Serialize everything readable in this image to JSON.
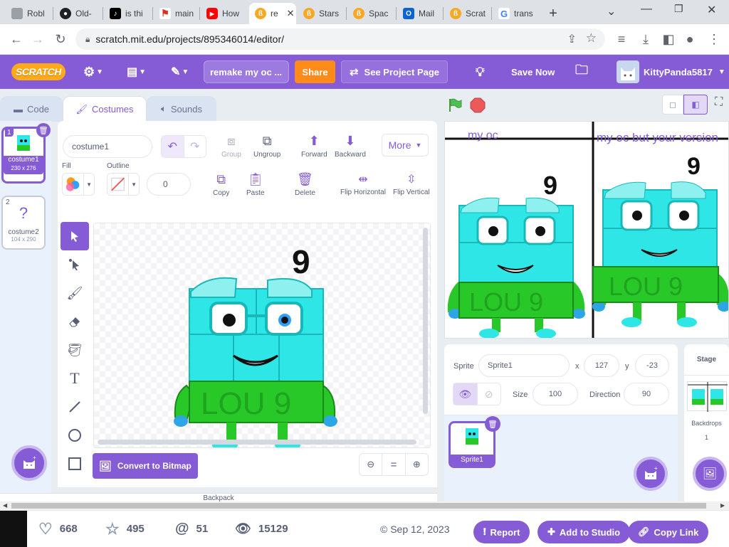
{
  "browser": {
    "tabs": [
      {
        "label": "Robl",
        "icon": "roblox-icon",
        "color": "#9aa0a6"
      },
      {
        "label": "Old-",
        "icon": "github-icon",
        "color": "#202124"
      },
      {
        "label": "is thi",
        "icon": "tiktok-icon",
        "color": "#000000"
      },
      {
        "label": "main",
        "icon": "flag-icon",
        "color": "#d93025"
      },
      {
        "label": "How",
        "icon": "youtube-icon",
        "color": "#ff0000"
      },
      {
        "label": "re",
        "icon": "scratch-tab-icon",
        "color": "#f9a825"
      },
      {
        "label": "Stars",
        "icon": "scratch-tab-icon",
        "color": "#f9a825"
      },
      {
        "label": "Spac",
        "icon": "scratch-tab-icon",
        "color": "#f9a825"
      },
      {
        "label": "Mail",
        "icon": "outlook-icon",
        "color": "#0a64d4"
      },
      {
        "label": "Scrat",
        "icon": "scratch-tab-icon",
        "color": "#f9a825"
      },
      {
        "label": "trans",
        "icon": "google-icon",
        "color": "#4285f4"
      }
    ],
    "new_tab": "+",
    "url": "scratch.mit.edu/projects/895346014/editor/"
  },
  "menubar": {
    "logo": "SCRATCH",
    "project_title": "remake my oc ...",
    "share": "Share",
    "see_project_page": "See Project Page",
    "save_now": "Save Now",
    "username": "KittyPanda5817"
  },
  "editor_tabs": {
    "code": "Code",
    "costumes": "Costumes",
    "sounds": "Sounds"
  },
  "costumes": [
    {
      "index": "1",
      "name": "costume1",
      "size": "230 x 276",
      "selected": true
    },
    {
      "index": "2",
      "name": "costume2",
      "size": "104 x 290",
      "selected": false
    }
  ],
  "paint": {
    "costume_name": "costume1",
    "group": "Group",
    "ungroup": "Ungroup",
    "forward": "Forward",
    "backward": "Backward",
    "more": "More",
    "fill_label": "Fill",
    "outline_label": "Outline",
    "outline_width": "0",
    "copy": "Copy",
    "paste": "Paste",
    "delete": "Delete",
    "flip_h": "Flip Horizontal",
    "flip_v": "Flip Vertical",
    "convert": "Convert to Bitmap",
    "zoom_reset": "="
  },
  "stage": {
    "label_left": "my oc",
    "label_right": "my oc but your version",
    "digit": "9",
    "tag": "LOU 9"
  },
  "sprite_info": {
    "sprite_label": "Sprite",
    "sprite_name": "Sprite1",
    "x_label": "x",
    "x": "127",
    "y_label": "y",
    "y": "-23",
    "show_label": "Show",
    "size_label": "Size",
    "size": "100",
    "direction_label": "Direction",
    "direction": "90",
    "sprite_thumb_label": "Sprite1"
  },
  "stage_pane": {
    "title": "Stage",
    "backdrops_label": "Backdrops",
    "backdrops_count": "1"
  },
  "backpack": "Backpack",
  "footer": {
    "loves": "668",
    "favorites": "495",
    "remixes": "51",
    "views": "15129",
    "date": "© Sep 12, 2023",
    "report": "Report",
    "add_to_studio": "Add to Studio",
    "copy_link": "Copy Link"
  },
  "colors": {
    "scratch_purple": "#855cd6",
    "share_orange": "#ff8c1a",
    "cyan": "#2ee6e6"
  }
}
